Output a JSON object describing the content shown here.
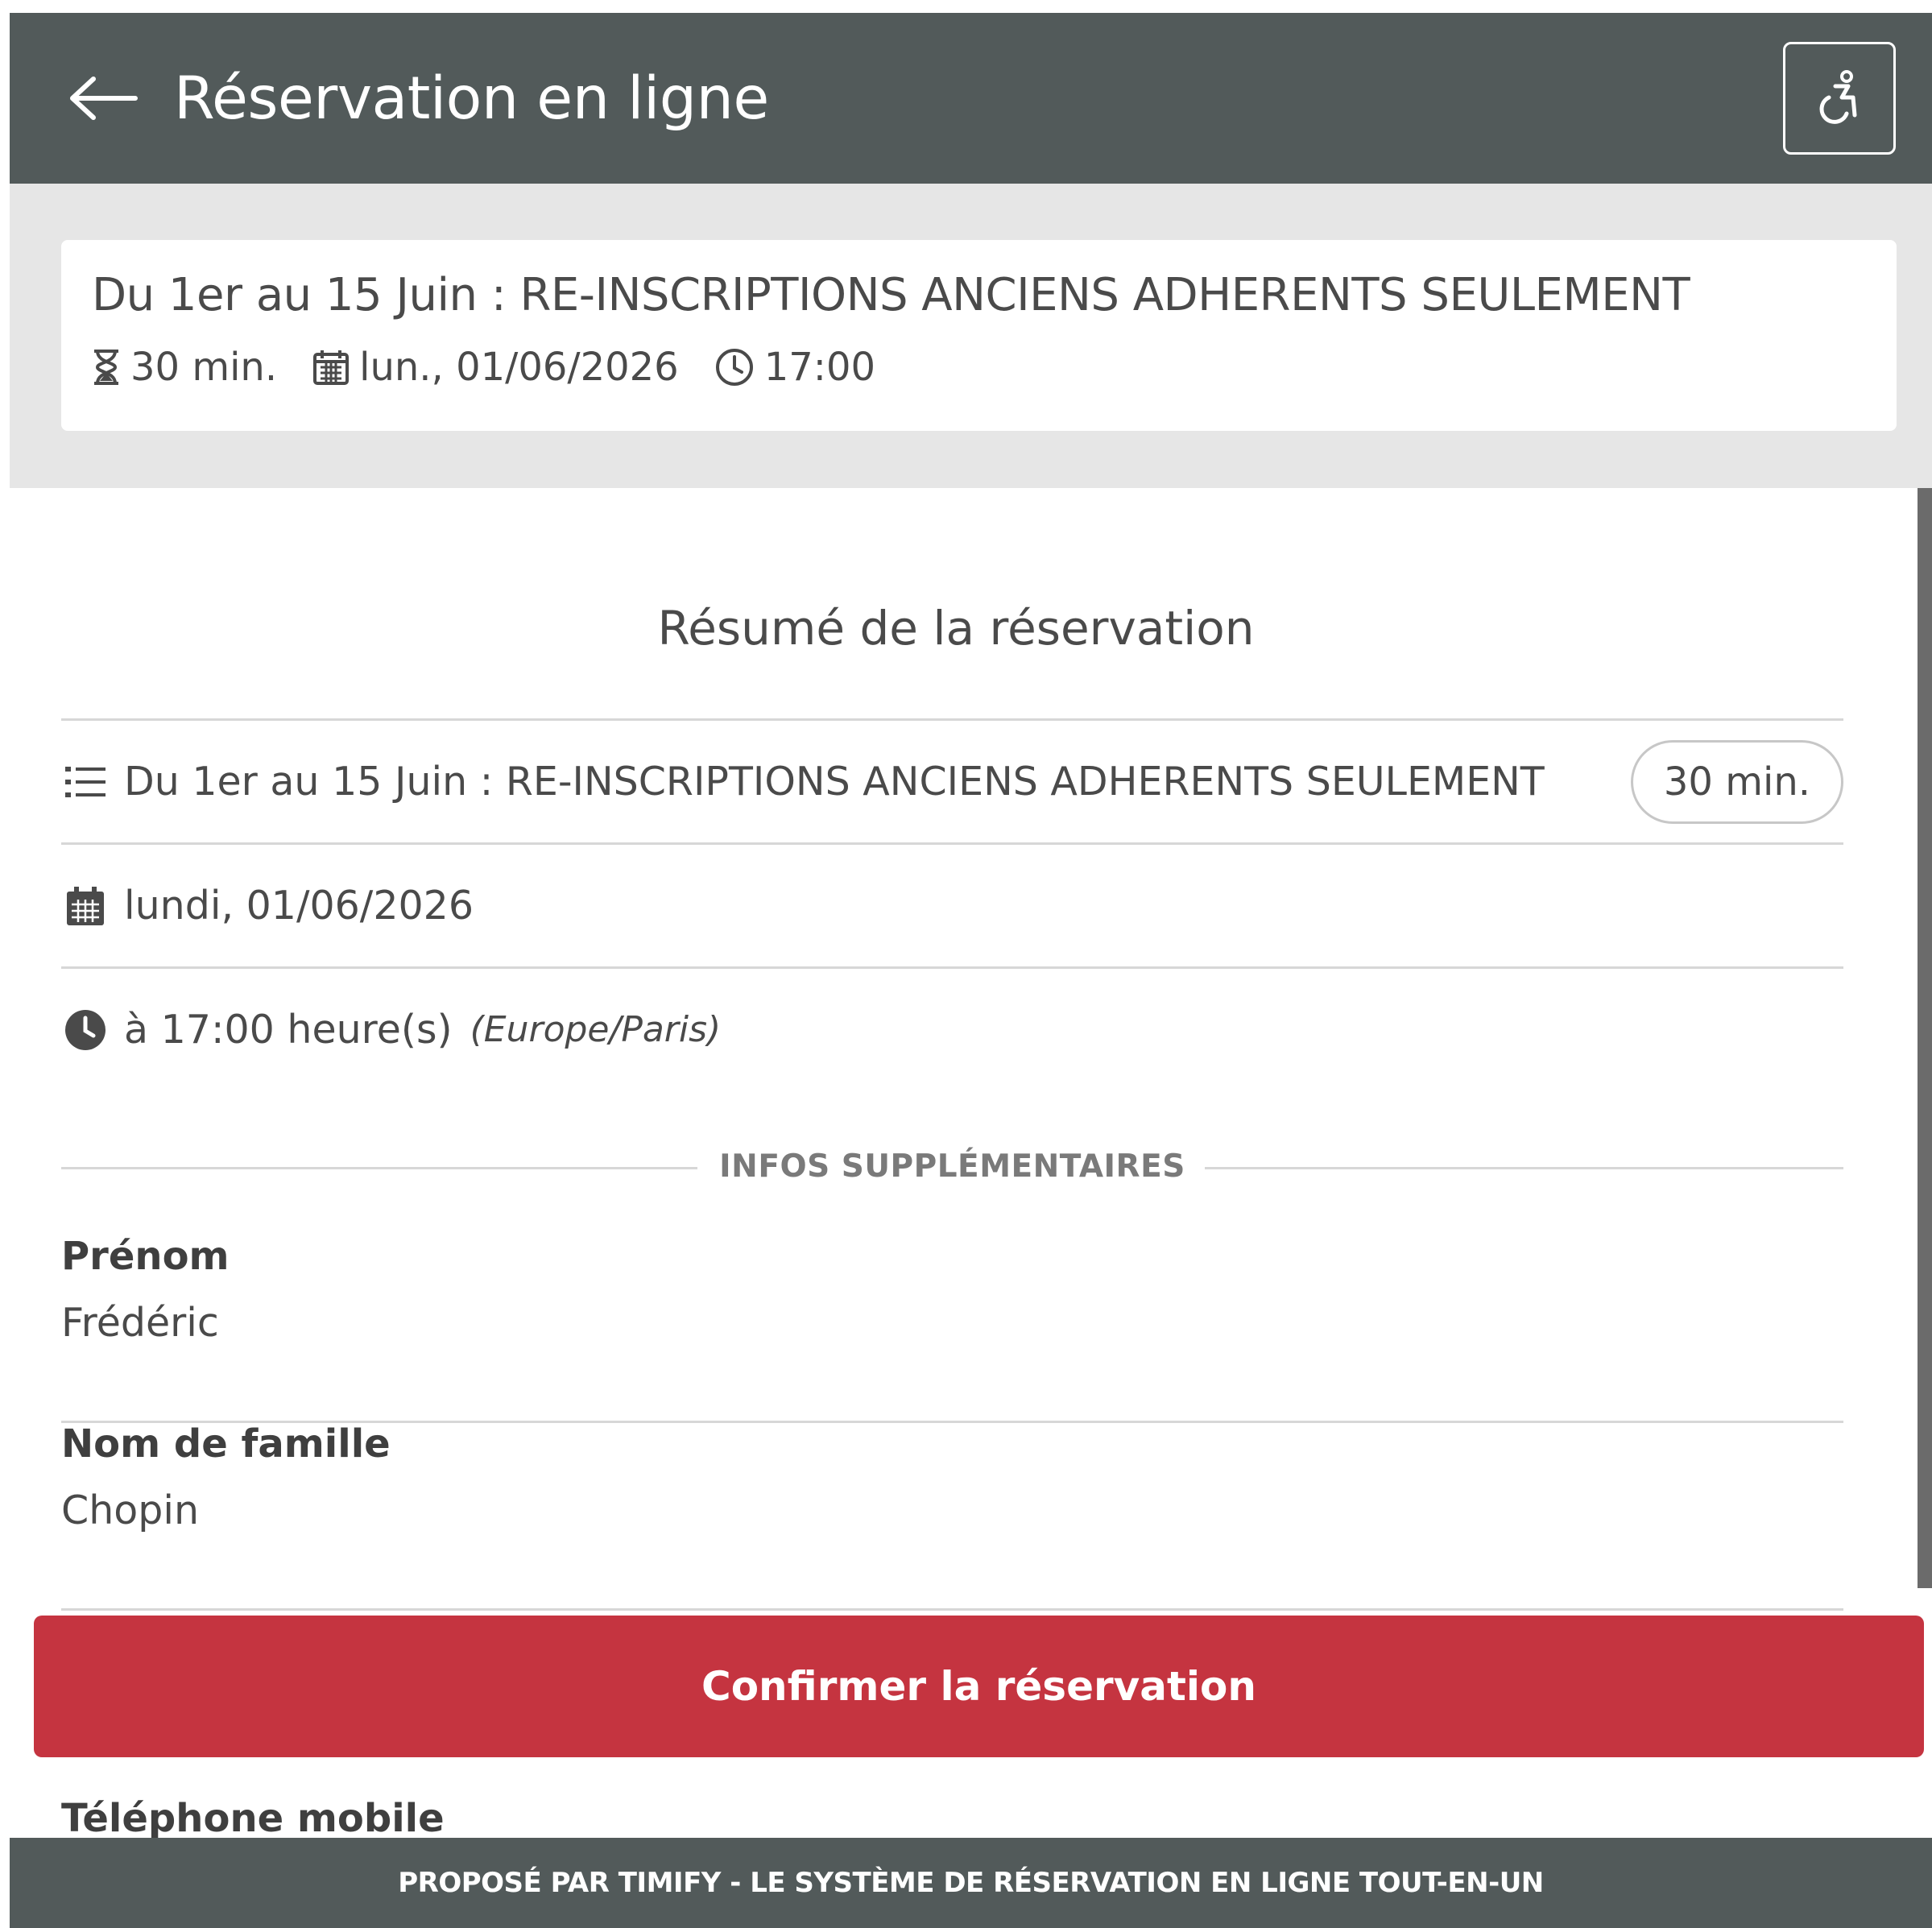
{
  "header": {
    "title": "Réservation en ligne",
    "back_icon": "arrow-left-icon",
    "accessibility_icon": "wheelchair-icon"
  },
  "service_card": {
    "title": "Du 1er au 15 Juin : RE-INSCRIPTIONS ANCIENS ADHERENTS SEULEMENT",
    "duration": "30 min.",
    "date": "lun., 01/06/2026",
    "time": "17:00"
  },
  "summary": {
    "title": "Résumé de la réservation",
    "service_name": "Du 1er au 15 Juin : RE-INSCRIPTIONS ANCIENS ADHERENTS SEULEMENT",
    "duration_badge": "30 min.",
    "date": "lundi, 01/06/2026",
    "time": "à 17:00 heure(s)",
    "timezone": "(Europe/Paris)"
  },
  "extra_info": {
    "section_label": "INFOS SUPPLÉMENTAIRES",
    "fields": [
      {
        "label": "Prénom",
        "value": "Frédéric"
      },
      {
        "label": "Nom de famille",
        "value": "Chopin"
      },
      {
        "label": "Téléphone mobile",
        "value": ""
      }
    ]
  },
  "confirm_button": {
    "label": "Confirmer la réservation"
  },
  "footer": {
    "text": "PROPOSÉ PAR TIMIFY - LE SYSTÈME DE RÉSERVATION EN LIGNE TOUT-EN-UN"
  },
  "colors": {
    "header_bg": "#525a5a",
    "strip_bg": "#e6e6e6",
    "accent": "#c53440",
    "text": "#4a4a4a"
  }
}
